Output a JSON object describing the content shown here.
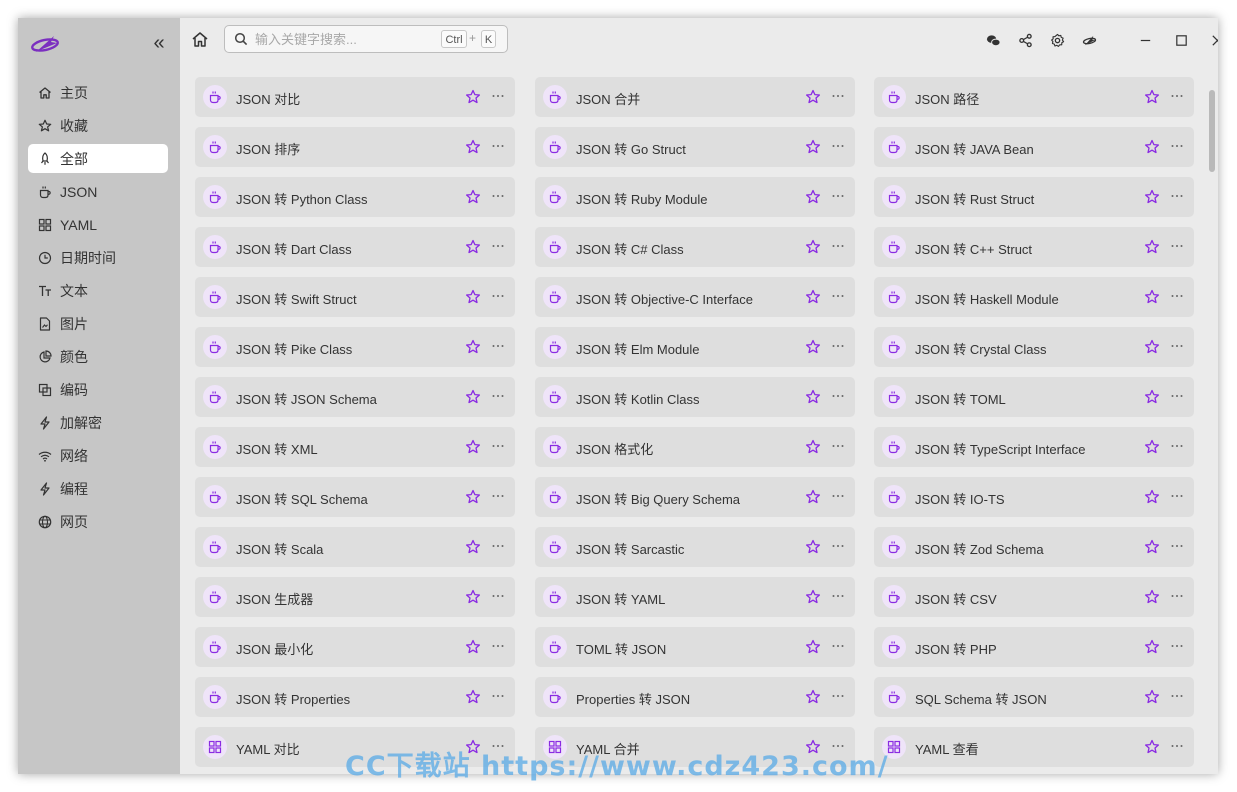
{
  "app": {
    "logo_icon": "airplane-logo-icon",
    "accent_color": "#8a2be2"
  },
  "sidebar": {
    "collapse_icon": "double-chevron-left-icon",
    "items": [
      {
        "label": "主页",
        "icon": "home-icon",
        "active": false
      },
      {
        "label": "收藏",
        "icon": "star-icon",
        "active": false
      },
      {
        "label": "全部",
        "icon": "rocket-icon",
        "active": true
      },
      {
        "label": "JSON",
        "icon": "cup-icon",
        "active": false
      },
      {
        "label": "YAML",
        "icon": "grid-icon",
        "active": false
      },
      {
        "label": "日期时间",
        "icon": "clock-icon",
        "active": false
      },
      {
        "label": "文本",
        "icon": "text-icon",
        "active": false
      },
      {
        "label": "图片",
        "icon": "image-file-icon",
        "active": false
      },
      {
        "label": "颜色",
        "icon": "pie-icon",
        "active": false
      },
      {
        "label": "编码",
        "icon": "copy-icon",
        "active": false
      },
      {
        "label": "加解密",
        "icon": "bolt-icon",
        "active": false
      },
      {
        "label": "网络",
        "icon": "wifi-icon",
        "active": false
      },
      {
        "label": "编程",
        "icon": "bolt-icon",
        "active": false
      },
      {
        "label": "网页",
        "icon": "globe-icon",
        "active": false
      }
    ]
  },
  "toolbar": {
    "search_placeholder": "输入关键字搜索...",
    "shortcut_ctrl": "Ctrl",
    "shortcut_plus": "+",
    "shortcut_key": "K",
    "buttons": [
      "wechat-icon",
      "share-icon",
      "settings-icon",
      "airplane-icon",
      "minimize-icon",
      "maximize-icon",
      "close-icon"
    ]
  },
  "tools": [
    {
      "label": "JSON 对比",
      "icon": "cup-icon"
    },
    {
      "label": "JSON 合并",
      "icon": "cup-icon"
    },
    {
      "label": "JSON 路径",
      "icon": "cup-icon"
    },
    {
      "label": "JSON 排序",
      "icon": "cup-icon"
    },
    {
      "label": "JSON 转 Go Struct",
      "icon": "cup-icon"
    },
    {
      "label": "JSON 转 JAVA Bean",
      "icon": "cup-icon"
    },
    {
      "label": "JSON 转 Python Class",
      "icon": "cup-icon"
    },
    {
      "label": "JSON 转 Ruby Module",
      "icon": "cup-icon"
    },
    {
      "label": "JSON 转 Rust Struct",
      "icon": "cup-icon"
    },
    {
      "label": "JSON 转 Dart Class",
      "icon": "cup-icon"
    },
    {
      "label": "JSON 转 C# Class",
      "icon": "cup-icon"
    },
    {
      "label": "JSON 转 C++ Struct",
      "icon": "cup-icon"
    },
    {
      "label": "JSON 转 Swift Struct",
      "icon": "cup-icon"
    },
    {
      "label": "JSON 转 Objective-C Interface",
      "icon": "cup-icon"
    },
    {
      "label": "JSON 转 Haskell Module",
      "icon": "cup-icon"
    },
    {
      "label": "JSON 转 Pike Class",
      "icon": "cup-icon"
    },
    {
      "label": "JSON 转 Elm Module",
      "icon": "cup-icon"
    },
    {
      "label": "JSON 转 Crystal Class",
      "icon": "cup-icon"
    },
    {
      "label": "JSON 转 JSON Schema",
      "icon": "cup-icon"
    },
    {
      "label": "JSON 转 Kotlin Class",
      "icon": "cup-icon"
    },
    {
      "label": "JSON 转 TOML",
      "icon": "cup-icon"
    },
    {
      "label": "JSON 转 XML",
      "icon": "cup-icon"
    },
    {
      "label": "JSON 格式化",
      "icon": "cup-icon"
    },
    {
      "label": "JSON 转 TypeScript Interface",
      "icon": "cup-icon"
    },
    {
      "label": "JSON 转 SQL Schema",
      "icon": "cup-icon"
    },
    {
      "label": "JSON 转 Big Query Schema",
      "icon": "cup-icon"
    },
    {
      "label": "JSON 转 IO-TS",
      "icon": "cup-icon"
    },
    {
      "label": "JSON 转 Scala",
      "icon": "cup-icon"
    },
    {
      "label": "JSON 转 Sarcastic",
      "icon": "cup-icon"
    },
    {
      "label": "JSON 转 Zod Schema",
      "icon": "cup-icon"
    },
    {
      "label": "JSON 生成器",
      "icon": "cup-icon"
    },
    {
      "label": "JSON 转 YAML",
      "icon": "cup-icon"
    },
    {
      "label": "JSON 转 CSV",
      "icon": "cup-icon"
    },
    {
      "label": "JSON 最小化",
      "icon": "cup-icon"
    },
    {
      "label": "TOML 转 JSON",
      "icon": "cup-icon"
    },
    {
      "label": "JSON 转 PHP",
      "icon": "cup-icon"
    },
    {
      "label": "JSON 转 Properties",
      "icon": "cup-icon"
    },
    {
      "label": "Properties 转 JSON",
      "icon": "cup-icon"
    },
    {
      "label": "SQL Schema 转 JSON",
      "icon": "cup-icon"
    },
    {
      "label": "YAML 对比",
      "icon": "grid-icon"
    },
    {
      "label": "YAML 合并",
      "icon": "grid-icon"
    },
    {
      "label": "YAML 查看",
      "icon": "grid-icon"
    }
  ],
  "watermark": "CC下载站 https://www.cdz423.com/"
}
